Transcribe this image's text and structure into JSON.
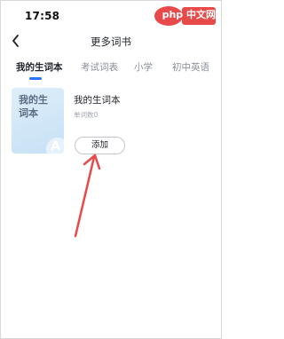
{
  "status_bar": {
    "time": "17:58",
    "watermark": "php 中文网"
  },
  "nav": {
    "title": "更多词书",
    "back_icon": "chevron-left-icon"
  },
  "tabs": [
    {
      "label": "我的生词本",
      "active": true
    },
    {
      "label": "考试词表",
      "active": false
    },
    {
      "label": "小学",
      "active": false
    },
    {
      "label": "初中英语",
      "active": false
    }
  ],
  "book": {
    "cover_text": "我的生词本",
    "cover_letter": "A",
    "title": "我的生词本",
    "count_text": "单词数0",
    "add_label": "添加"
  },
  "colors": {
    "accent": "#2b72ff",
    "annotation_arrow": "#e84a4a",
    "watermark": "#e84a4a"
  }
}
